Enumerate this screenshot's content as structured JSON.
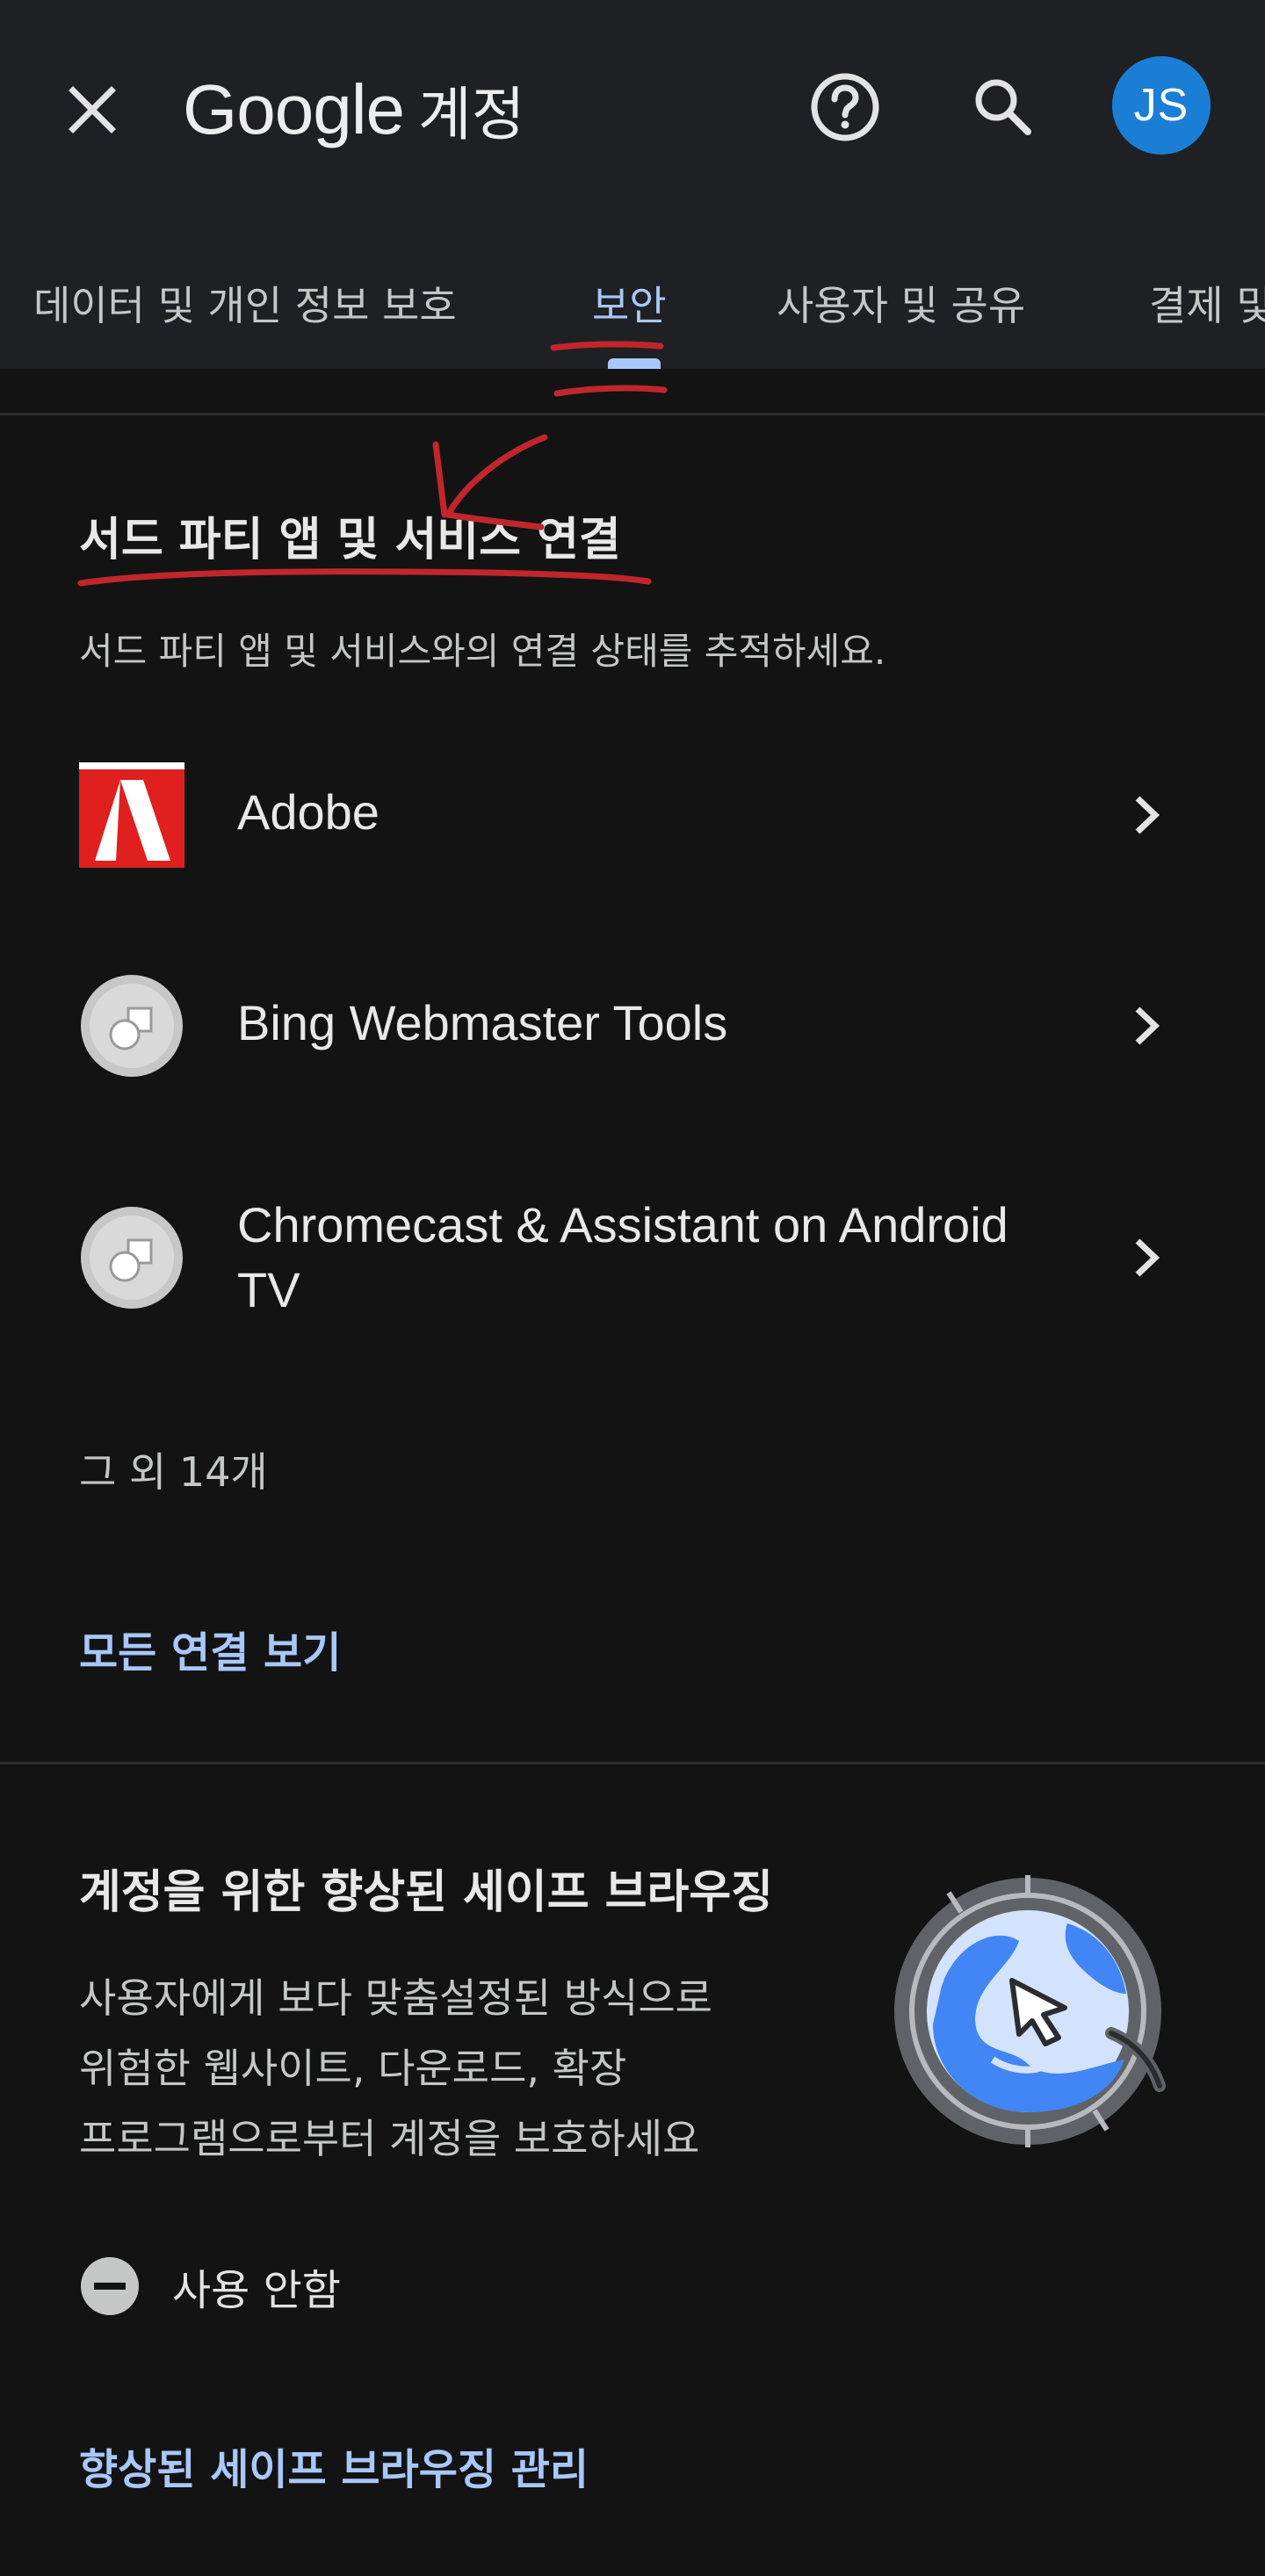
{
  "header": {
    "brand_name": "Google",
    "brand_suffix": "계정",
    "avatar_initials": "JS",
    "avatar_color": "#1a7fd4"
  },
  "tabs": [
    {
      "label": "데이터 및 개인 정보 보호",
      "active": false
    },
    {
      "label": "보안",
      "active": true
    },
    {
      "label": "사용자 및 공유",
      "active": false
    },
    {
      "label": "결제 및 구독",
      "active": false
    }
  ],
  "third_party": {
    "title": "서드 파티 앱 및 서비스 연결",
    "description": "서드 파티 앱 및 서비스와의 연결 상태를 추적하세요.",
    "apps": [
      {
        "name": "Adobe",
        "icon": "adobe-logo-icon"
      },
      {
        "name": "Bing Webmaster Tools",
        "icon": "generic-app-icon"
      },
      {
        "name": "Chromecast & Assistant on Android TV",
        "icon": "generic-app-icon"
      }
    ],
    "more_count": "그 외 14개",
    "view_all_link": "모든 연결 보기"
  },
  "safe_browsing": {
    "title": "계정을 위한 향상된 세이프 브라우징",
    "description_lines": [
      "사용자에게 보다 맞춤설정된 방식으로",
      "위험한 웹사이트, 다운로드, 확장",
      "프로그램으로부터 계정을 보호하세요"
    ],
    "status": "사용 안함",
    "manage_link": "향상된 세이프 브라우징 관리"
  },
  "colors": {
    "background": "#131313",
    "header_background": "#1f2023",
    "accent": "#a8c7fa",
    "annotation": "#c0262b"
  }
}
